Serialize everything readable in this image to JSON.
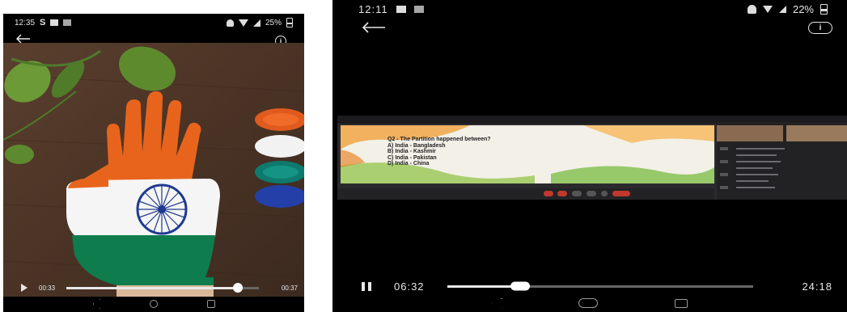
{
  "left_screenshot": {
    "status_bar": {
      "time": "12:35",
      "battery": "25%"
    },
    "video": {
      "elapsed": "00:33",
      "duration": "00:37",
      "progress": 0.89
    }
  },
  "right_screenshot": {
    "status_bar": {
      "time": "12:11",
      "battery": "22%"
    },
    "video": {
      "elapsed": "06:32",
      "duration": "24:18",
      "progress": 0.24
    },
    "meeting_slide": {
      "question": "Q2 - The Partition happened between?",
      "options": [
        "A) India - Bangladesh",
        "B) India - Kashmir",
        "C) India - Pakistan",
        "D) India - China"
      ]
    }
  }
}
